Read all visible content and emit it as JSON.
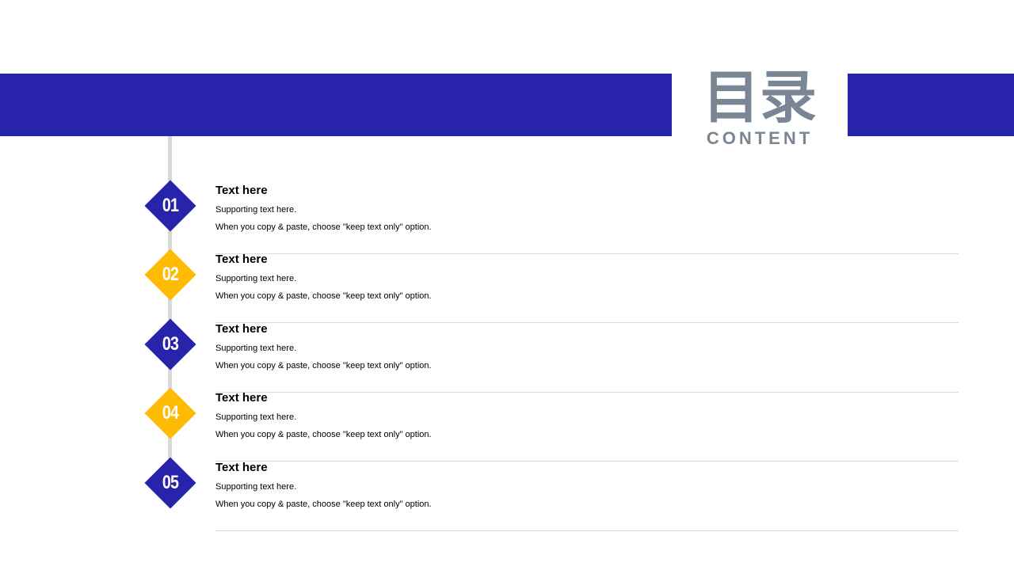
{
  "header": {
    "title": "目录",
    "subtitle": "CONTENT"
  },
  "colors": {
    "primary": "#2724ab",
    "accent": "#fdbb03",
    "title_gray": "#7a8595",
    "line_gray": "#d9d9d9"
  },
  "items": [
    {
      "number": "01",
      "title": "Text here",
      "line1": "Supporting text here.",
      "line2": "When you copy & paste, choose \"keep text only\" option.",
      "color": "#2724ab"
    },
    {
      "number": "02",
      "title": "Text here",
      "line1": "Supporting text here.",
      "line2": "When you copy & paste, choose \"keep text only\" option.",
      "color": "#fdbb03"
    },
    {
      "number": "03",
      "title": "Text here",
      "line1": "Supporting text here.",
      "line2": "When you copy & paste, choose \"keep text only\" option.",
      "color": "#2724ab"
    },
    {
      "number": "04",
      "title": "Text here",
      "line1": "Supporting text here.",
      "line2": "When you copy & paste, choose \"keep text only\" option.",
      "color": "#fdbb03"
    },
    {
      "number": "05",
      "title": "Text here",
      "line1": "Supporting text here.",
      "line2": "When you copy & paste, choose \"keep text only\" option.",
      "color": "#2724ab"
    }
  ]
}
